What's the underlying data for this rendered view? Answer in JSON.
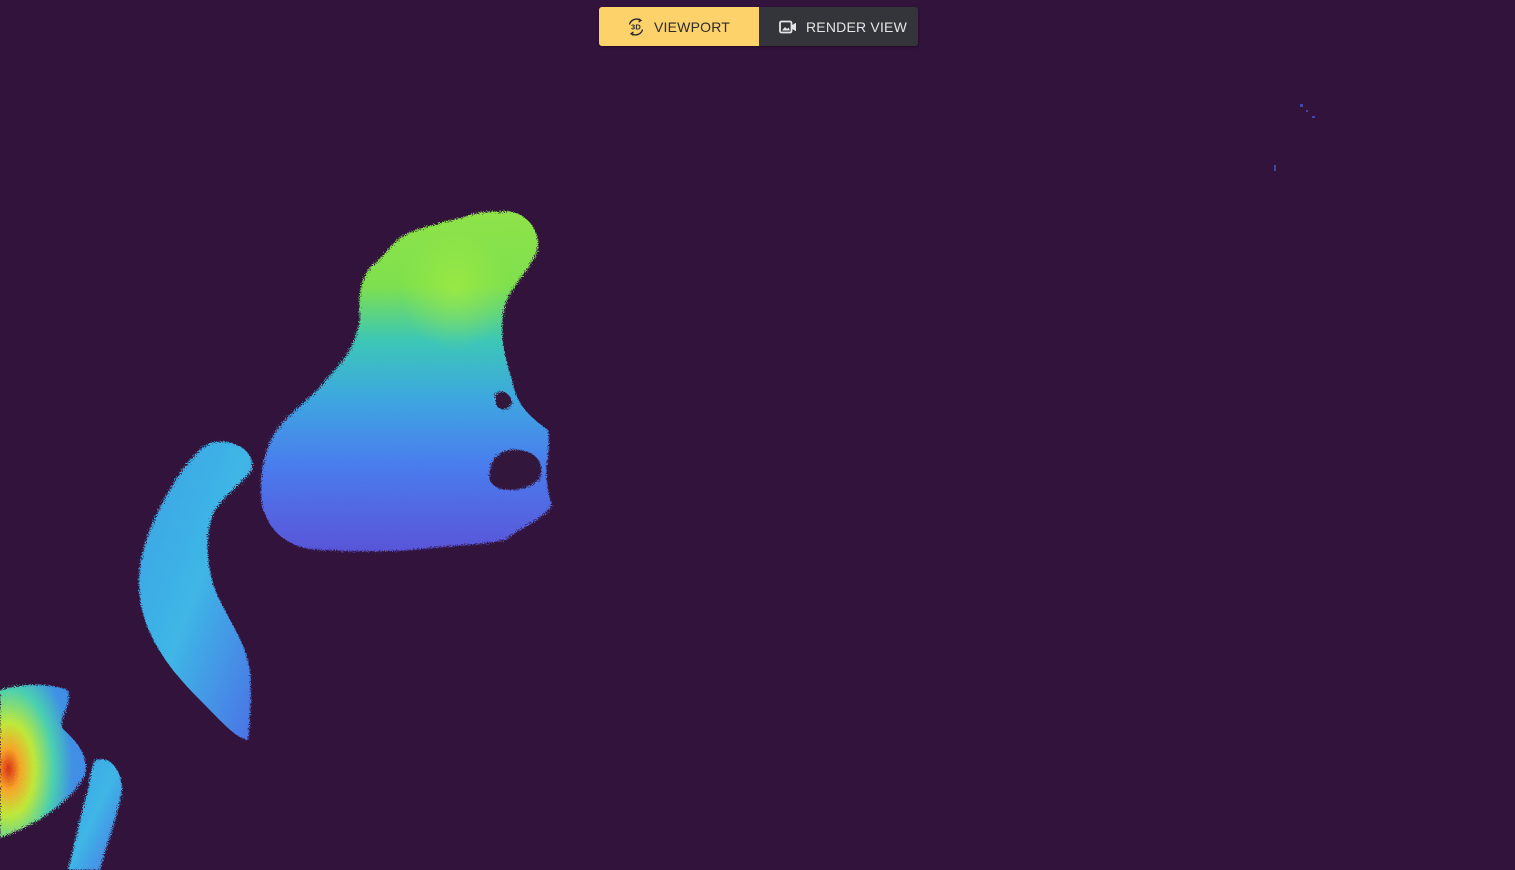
{
  "view_toggle": {
    "viewport": {
      "label": "VIEWPORT",
      "icon": "3d-rotation-icon",
      "icon_text": "3D",
      "active": true
    },
    "render_view": {
      "label": "RENDER VIEW",
      "icon": "camera-image-icon",
      "active": false
    }
  },
  "colors": {
    "background": "#32133b",
    "active_toggle": "#fdd26a",
    "inactive_toggle": "#34343b",
    "heatmap_low": "#4a62e8",
    "heatmap_mid": "#3ec3d8",
    "heatmap_high": "#9ee63a",
    "heatmap_peak": "#e8501e"
  }
}
